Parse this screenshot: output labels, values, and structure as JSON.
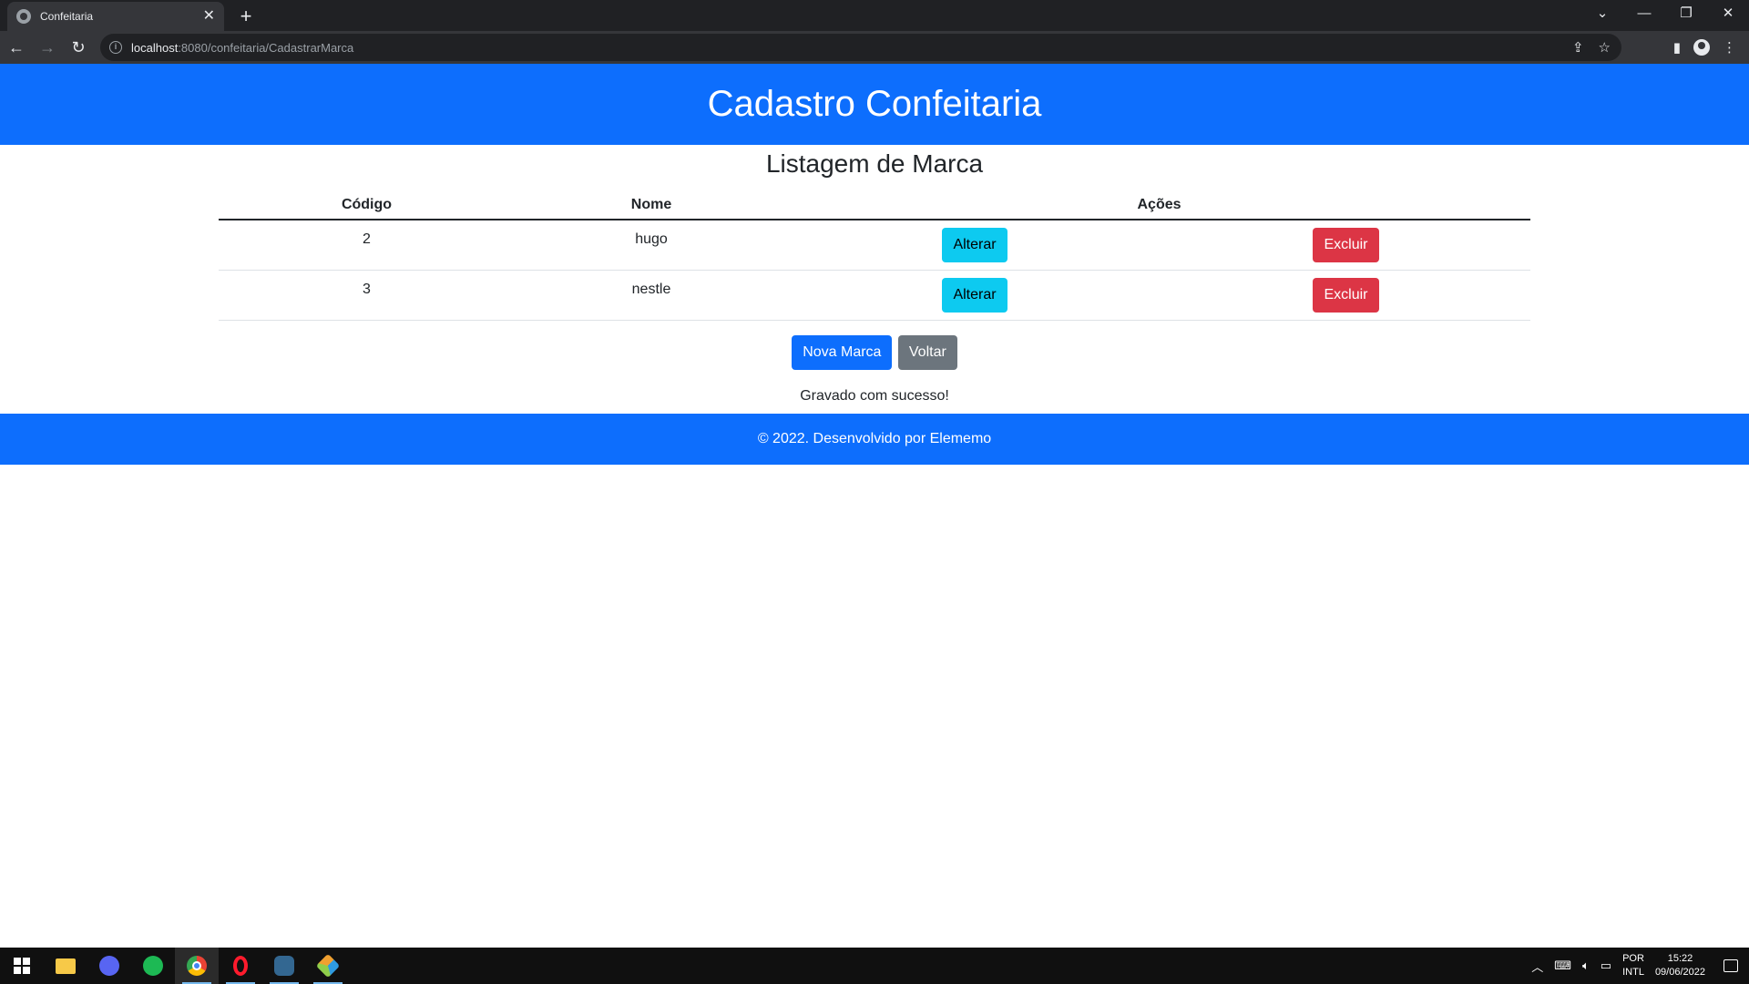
{
  "browser": {
    "tab_title": "Confeitaria",
    "tab_close": "✕",
    "new_tab": "+",
    "url_host": "localhost",
    "url_path": ":8080/confeitaria/CadastrarMarca",
    "window_controls": [
      "⌄",
      "—",
      "❐",
      "✕"
    ]
  },
  "page": {
    "header_title": "Cadastro Confeitaria",
    "list_title": "Listagem de Marca",
    "table": {
      "headers": [
        "Código",
        "Nome",
        "Ações"
      ],
      "rows": [
        {
          "codigo": "2",
          "nome": "hugo",
          "alterar": "Alterar",
          "excluir": "Excluir"
        },
        {
          "codigo": "3",
          "nome": "nestle",
          "alterar": "Alterar",
          "excluir": "Excluir"
        }
      ]
    },
    "buttons": {
      "nova_marca": "Nova Marca",
      "voltar": "Voltar"
    },
    "message": "Gravado com sucesso!",
    "footer": "© 2022. Desenvolvido por Elememo"
  },
  "colors": {
    "primary": "#0d6efd",
    "info": "#0dcaf0",
    "danger": "#dc3545",
    "secondary": "#6c757d"
  },
  "taskbar": {
    "apps": [
      "start-icon",
      "file-explorer-icon",
      "discord-icon",
      "spotify-icon",
      "chrome-icon",
      "opera-icon",
      "pgadmin-icon",
      "netbeans-icon"
    ],
    "lang_top": "POR",
    "lang_bottom": "INTL",
    "time": "15:22",
    "date": "09/06/2022"
  }
}
